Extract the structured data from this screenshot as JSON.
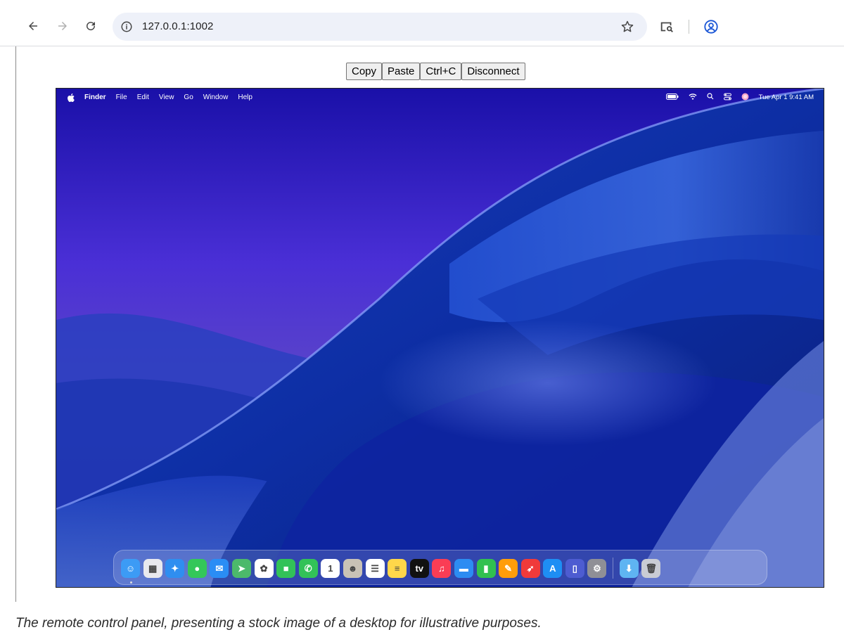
{
  "browser": {
    "url": "127.0.0.1:1002"
  },
  "controls": {
    "copy": "Copy",
    "paste": "Paste",
    "ctrl_c": "Ctrl+C",
    "disconnect": "Disconnect"
  },
  "mac": {
    "app_name": "Finder",
    "menus": [
      "File",
      "Edit",
      "View",
      "Go",
      "Window",
      "Help"
    ],
    "clock": "Tue Apr 1  9:41 AM",
    "dock": [
      {
        "name": "finder-icon",
        "bg": "#3c9bf5",
        "glyph": "☺"
      },
      {
        "name": "launchpad-icon",
        "bg": "#e9e9ee",
        "glyph": "▦"
      },
      {
        "name": "safari-icon",
        "bg": "#2f8ef0",
        "glyph": "✦"
      },
      {
        "name": "messages-icon",
        "bg": "#34c759",
        "glyph": "●"
      },
      {
        "name": "mail-icon",
        "bg": "#2a8df5",
        "glyph": "✉"
      },
      {
        "name": "maps-icon",
        "bg": "#4cb96b",
        "glyph": "➤"
      },
      {
        "name": "photos-icon",
        "bg": "#ffffff",
        "glyph": "✿"
      },
      {
        "name": "facetime-icon",
        "bg": "#32c258",
        "glyph": "■"
      },
      {
        "name": "phone-icon",
        "bg": "#32c258",
        "glyph": "✆"
      },
      {
        "name": "calendar-icon",
        "bg": "#ffffff",
        "glyph": "1"
      },
      {
        "name": "contacts-icon",
        "bg": "#c9c2b6",
        "glyph": "☻"
      },
      {
        "name": "reminders-icon",
        "bg": "#ffffff",
        "glyph": "☰"
      },
      {
        "name": "notes-icon",
        "bg": "#ffd74a",
        "glyph": "≡"
      },
      {
        "name": "apple-tv-icon",
        "bg": "#111111",
        "glyph": "tv"
      },
      {
        "name": "music-icon",
        "bg": "#fa3d55",
        "glyph": "♫"
      },
      {
        "name": "keynote-icon",
        "bg": "#2c8cf2",
        "glyph": "▬"
      },
      {
        "name": "numbers-icon",
        "bg": "#31c150",
        "glyph": "▮"
      },
      {
        "name": "pages-icon",
        "bg": "#ff9d0a",
        "glyph": "✎"
      },
      {
        "name": "rocket-icon",
        "bg": "#f03a3a",
        "glyph": "➶"
      },
      {
        "name": "app-store-icon",
        "bg": "#1e8ef4",
        "glyph": "A"
      },
      {
        "name": "iphone-mirroring-icon",
        "bg": "#4d5cd1",
        "glyph": "▯"
      },
      {
        "name": "system-settings-icon",
        "bg": "#8f8f96",
        "glyph": "⚙"
      }
    ],
    "dock_right": [
      {
        "name": "downloads-folder-icon",
        "bg": "#5fb4f2",
        "glyph": "⬇"
      },
      {
        "name": "trash-icon",
        "bg": "#c9ccd4",
        "glyph": "🗑"
      }
    ]
  },
  "caption": "The remote control panel, presenting a stock image of a desktop for illustrative purposes."
}
